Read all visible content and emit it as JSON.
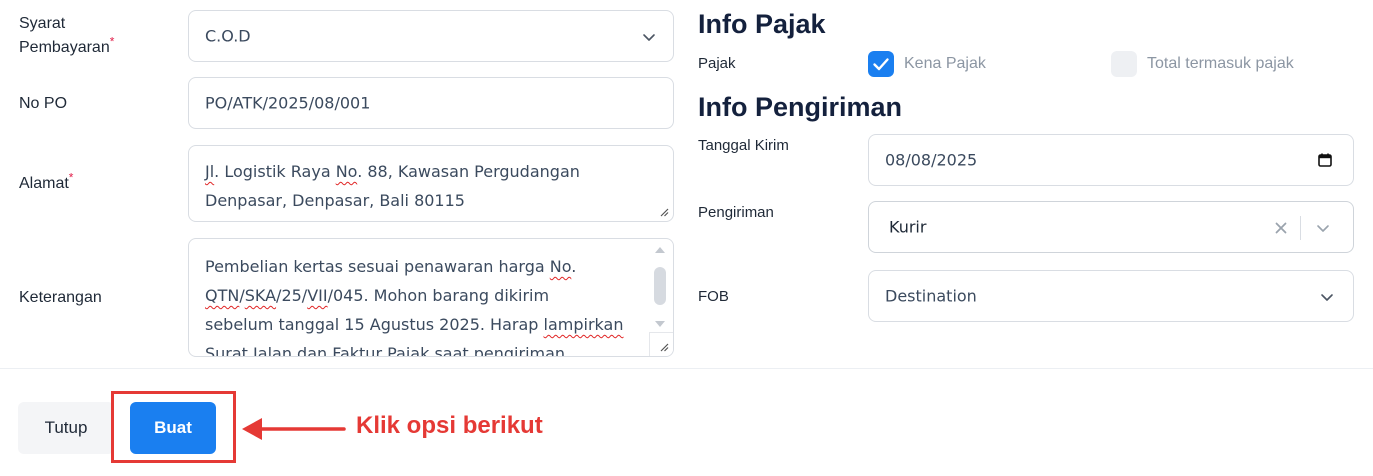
{
  "left": {
    "syarat": {
      "label_line1": "Syarat",
      "label_line2": "Pembayaran",
      "required_mark": "*",
      "value": "C.O.D"
    },
    "no_po": {
      "label": "No PO",
      "value": "PO/ATK/2025/08/001"
    },
    "alamat": {
      "label": "Alamat",
      "required_mark": "*",
      "line1_a": "Jl",
      "line1_b": ". Logistik Raya ",
      "line1_c": "No",
      "line1_d": ". 88, Kawasan Pergudangan",
      "line2": "Denpasar, Denpasar, Bali 80115"
    },
    "keterangan": {
      "label": "Keterangan",
      "l1_a": "Pembelian kertas sesuai penawaran harga ",
      "l1_b": "No",
      "l1_c": ".",
      "l2_a": "QTN",
      "l2_b": "/",
      "l2_c": "SKA",
      "l2_d": "/25/",
      "l2_e": "VII",
      "l2_f": "/045. Mohon barang dikirim",
      "l3_a": "sebelum tanggal 15 Agustus 2025. Harap ",
      "l3_b": "lampirkan",
      "l4": "Surat Jalan dan Faktur Pajak saat pengiriman."
    }
  },
  "info_pajak": {
    "title": "Info Pajak",
    "label": "Pajak",
    "kena_pajak": {
      "label": "Kena Pajak",
      "checked": true
    },
    "total_termasuk": {
      "label": "Total termasuk pajak",
      "checked": false
    }
  },
  "info_pengiriman": {
    "title": "Info Pengiriman",
    "tanggal_kirim": {
      "label": "Tanggal Kirim",
      "value": "08/08/2025"
    },
    "pengiriman": {
      "label": "Pengiriman",
      "value": "Kurir"
    },
    "fob": {
      "label": "FOB",
      "value": "Destination"
    }
  },
  "footer": {
    "close_label": "Tutup",
    "create_label": "Buat",
    "annotation": "Klik opsi berikut"
  },
  "colors": {
    "primary": "#1a7ff0",
    "annotation_red": "#e53935",
    "required_red": "#e11d48"
  },
  "icons": {
    "dropdown": "chevron-down-icon",
    "calendar": "calendar-icon",
    "clear": "clear-x-icon",
    "check": "checkmark-icon",
    "arrow": "arrow-left-icon"
  }
}
